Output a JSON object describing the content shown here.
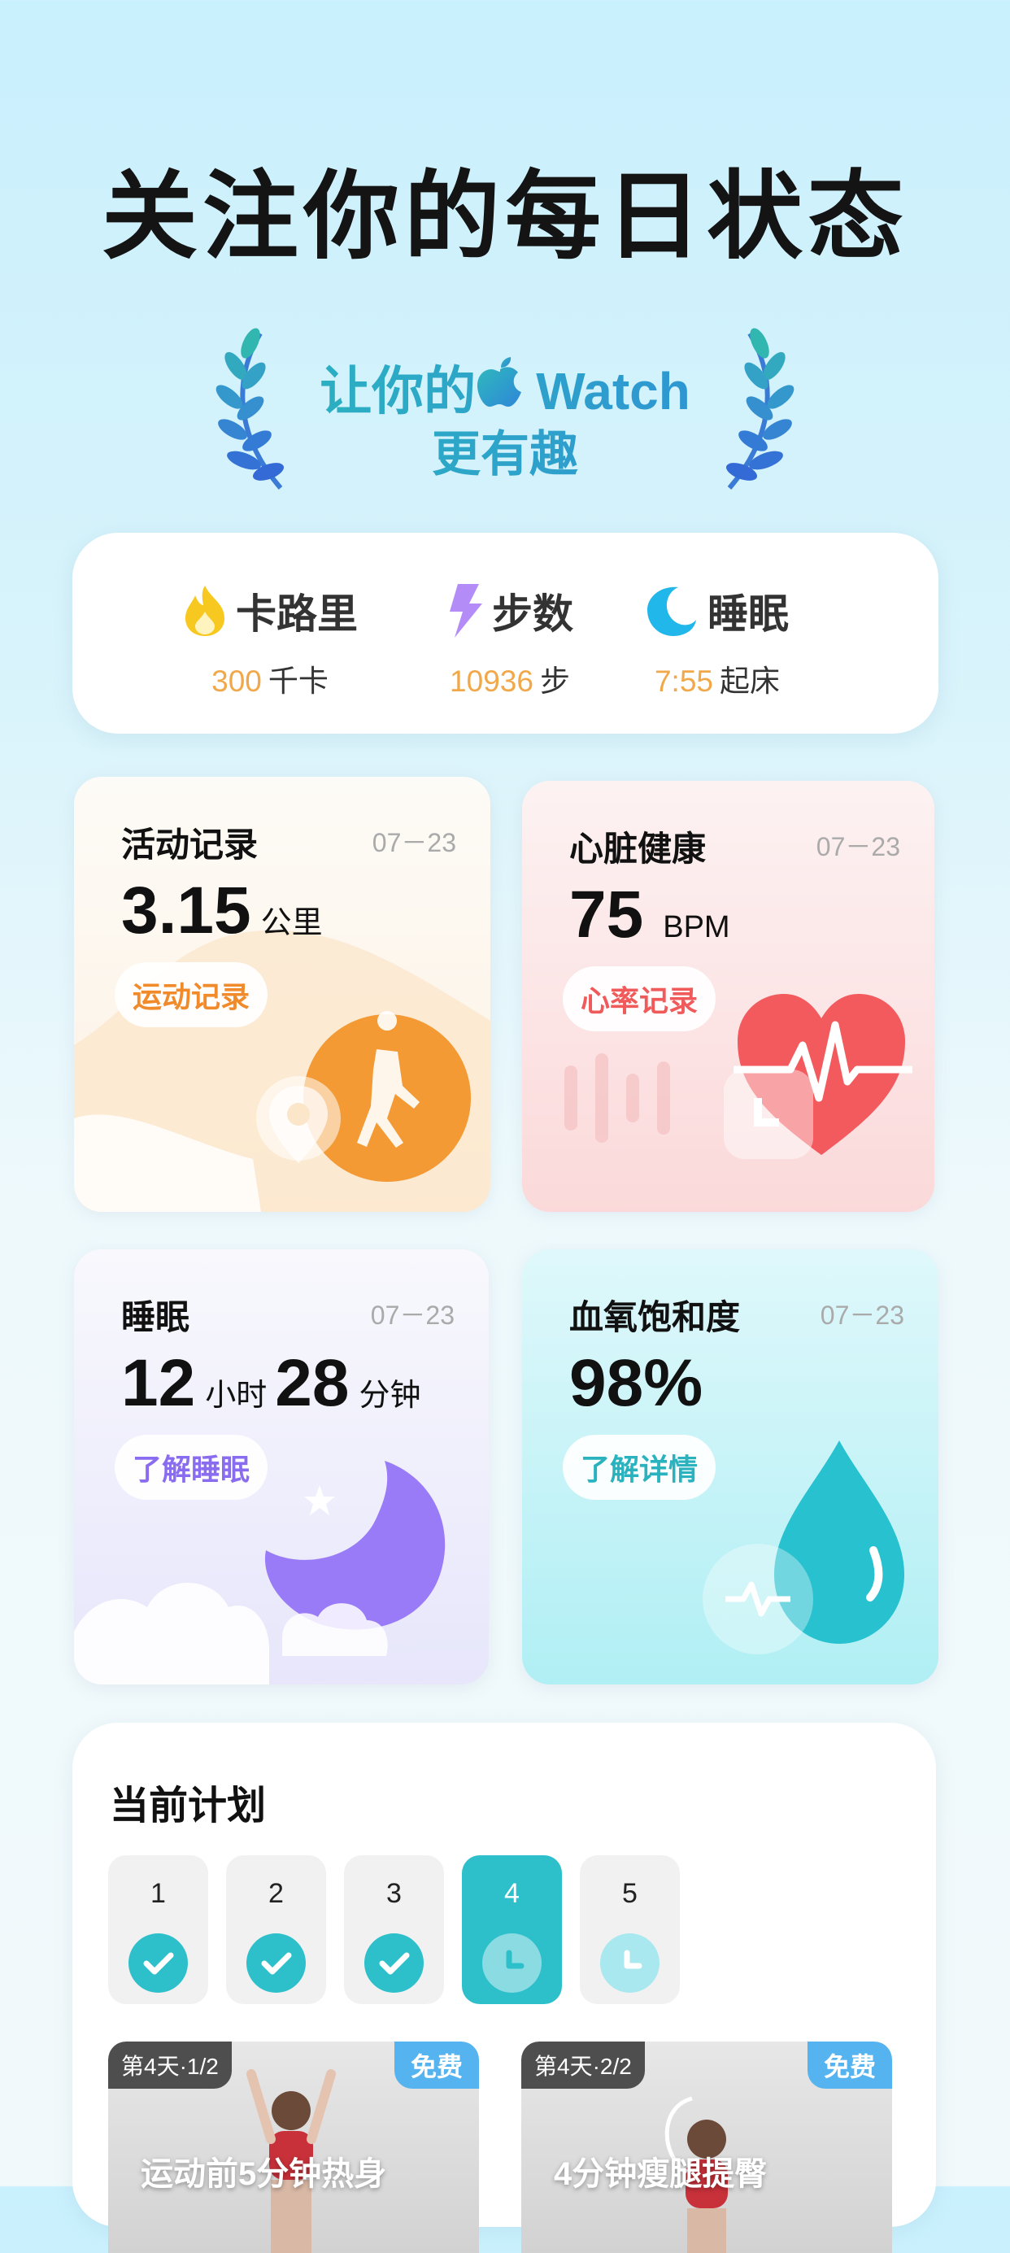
{
  "hero": {
    "title": "关注你的每日状态"
  },
  "badge": {
    "line1_prefix": "让你的",
    "line1_suffix": "Watch",
    "line2": "更有趣"
  },
  "stats": [
    {
      "icon": "flame-icon",
      "label": "卡路里",
      "value": "300",
      "unit": "千卡"
    },
    {
      "icon": "lightning-icon",
      "label": "步数",
      "value": "10936",
      "unit": "步"
    },
    {
      "icon": "moon-icon",
      "label": "睡眠",
      "value": "7:55",
      "unit": "起床"
    }
  ],
  "tiles": {
    "activity": {
      "title": "活动记录",
      "date": "07－23",
      "value": "3.15",
      "unit": "公里",
      "button": "运动记录",
      "accent": "#f08a2a"
    },
    "heart": {
      "title": "心脏健康",
      "date": "07－23",
      "value": "75",
      "unit": "BPM",
      "button": "心率记录",
      "accent": "#f05a5a"
    },
    "sleep": {
      "title": "睡眠",
      "date": "07－23",
      "hours": "12",
      "hours_unit": "小时",
      "minutes": "28",
      "minutes_unit": "分钟",
      "button": "了解睡眠",
      "accent": "#8a6cf0"
    },
    "oxygen": {
      "title": "血氧饱和度",
      "date": "07－23",
      "value": "98%",
      "button": "了解详情",
      "accent": "#2ab3be"
    }
  },
  "plan": {
    "title": "当前计划",
    "days": [
      {
        "n": "1",
        "state": "done"
      },
      {
        "n": "2",
        "state": "done"
      },
      {
        "n": "3",
        "state": "done"
      },
      {
        "n": "4",
        "state": "current"
      },
      {
        "n": "5",
        "state": "future"
      }
    ],
    "courses": [
      {
        "day_tag": "第4天·1/2",
        "free": "免费",
        "name": "运动前5分钟热身"
      },
      {
        "day_tag": "第4天·2/2",
        "free": "免费",
        "name": "4分钟瘦腿提臀"
      }
    ]
  }
}
